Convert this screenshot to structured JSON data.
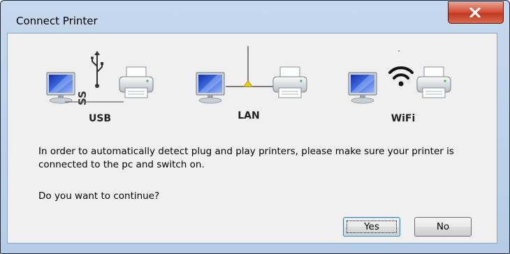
{
  "window": {
    "title": "Connect Printer"
  },
  "connections": [
    {
      "label": "USB",
      "icon": "usb-icon"
    },
    {
      "label": "LAN",
      "icon": "lan-cable-icon"
    },
    {
      "label": "WiFi",
      "icon": "wifi-icon"
    }
  ],
  "message": "In order to automatically detect plug and play printers, please make sure your printer is connected to the pc and switch on.",
  "question": "Do you want to continue?",
  "buttons": {
    "yes": "Yes",
    "no": "No"
  },
  "colors": {
    "close_button": "#c8452b",
    "lan_junction": "#f0d000",
    "monitor_screen": "#2a4cc8"
  }
}
